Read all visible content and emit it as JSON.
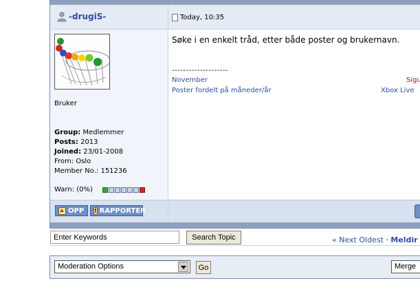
{
  "post": {
    "username": "-drugiS-",
    "timestamp": "Today, 10:35",
    "body": "Søke i en enkelt tråd, etter både poster og brukernavn.",
    "signature": {
      "divider": "--------------------",
      "link1": "November",
      "link2": "Poster fordelt på måneder/år",
      "red_text": "Sigu",
      "link3": "Xbox Live"
    }
  },
  "profile": {
    "rank": "Bruker",
    "group_label": "Group:",
    "group_value": "Medlemmer",
    "posts_label": "Posts:",
    "posts_value": "2013",
    "joined_label": "Joined:",
    "joined_value": "23/01-2008",
    "from_text": "From: Oslo",
    "member_no_text": "Member No.: 151236",
    "warn_text": "Warn: (0%)",
    "warn_level": 0
  },
  "buttons": {
    "opp": "OPP",
    "rapporter": "RAPPORTER"
  },
  "search": {
    "keywords_value": "Enter Keywords",
    "button": "Search Topic"
  },
  "nav": {
    "next_oldest": "« Next Oldest",
    "separator": "·",
    "next_partial": "Meldir"
  },
  "moderation": {
    "selected": "Moderation Options",
    "go": "Go",
    "merge": "Merge"
  },
  "icons": {
    "user": "user-icon",
    "post": "post-doc-icon",
    "up": "arrow-up-icon",
    "report": "exclamation-icon"
  },
  "colors": {
    "link": "#2b4ea1",
    "header_bg": "#e4ebf5",
    "strip": "#8fa0bf",
    "button_blue": "#6f8fc7"
  }
}
